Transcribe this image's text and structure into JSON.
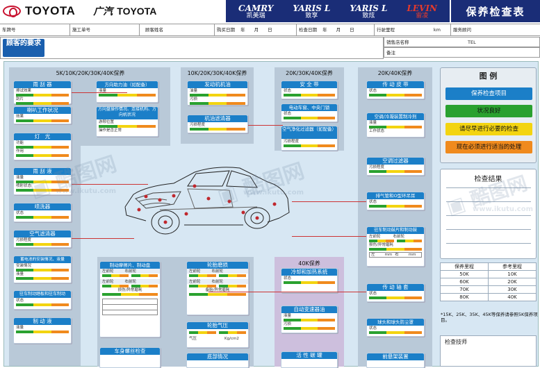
{
  "header": {
    "brand_toyota": "TOYOTA",
    "brand_gac": "广汽",
    "brand_gac_toyota": "TOYOTA",
    "models": [
      {
        "en": "CAMRY",
        "cn": "凯美瑞"
      },
      {
        "en": "YARIS L",
        "cn": "致享"
      },
      {
        "en": "YARIS L",
        "cn": "致炫"
      },
      {
        "en": "LEVIN",
        "cn": "雷凌"
      }
    ],
    "title": "保养检查表"
  },
  "form": {
    "plate": "车牌号",
    "work_order": "施工单号",
    "customer": "顾客姓名",
    "purchase_date": "购买日期",
    "purchase_ymd": "年　　月　　日",
    "inspect_date": "检查日期",
    "inspect_ymd": "年　　月　　日",
    "mileage": "行驶里程",
    "km": "km",
    "advisor": "服务顾问",
    "request_label": "顾客的要求",
    "dealer": "销售店名称",
    "tel": "TEL",
    "remark": "备注"
  },
  "columns": {
    "c1": "5K/10K/20K/30K/40K保养",
    "c2": "10K/20K/30K/40K保养",
    "c3": "20K/30K/40K保养",
    "c4": "20K/40K保养",
    "c5": "40K保养"
  },
  "cards": {
    "wiper": "雨 刮 器",
    "wiper_r1": "擦试效果",
    "wiper_r2": "刮片",
    "horn": "喇叭工作状况",
    "horn_r": "效果",
    "light": "灯　光",
    "light_r1": "功能",
    "light_r2": "作用",
    "washer_fluid": "雨 刮 液",
    "washer_r1": "液量",
    "washer_r2": "喷射状态",
    "washer": "喷洗器",
    "washer2_r": "状态",
    "aircleaner": "空气滤清器",
    "aircleaner_r": "污损程度",
    "battery": "蓄电池的安装情况、液量",
    "battery_r1": "安装情况",
    "battery_r2": "液量",
    "parking_brake": "驻车制动踏板和驻车制动",
    "pb_r": "状态",
    "brake_fluid": "制 动 液",
    "bf_r": "液量",
    "steering_fluid": "方向助力油（如配备）",
    "sf_r1": "液量",
    "sf_r2": "污损",
    "steering_op": "方向盘操作情况、连接机构、方向机状况",
    "so_r1": "游隙位置",
    "so_r2": "操作是否正常",
    "engine_oil": "发动机机油",
    "eo_r1": "油量",
    "eo_r2": "污损",
    "oil_filter": "机油滤清器",
    "of_r": "污损程度",
    "seatbelt": "安 全 带",
    "sb_r": "状态",
    "dashboard": "电动车窗、中央门锁",
    "db_r": "状态",
    "ac_filter_opt": "空气净化过滤器（如配备）",
    "acf_r": "污损程度",
    "drive_belt": "传 动 皮 带",
    "belt_r": "状态",
    "ac_refrigerant": "空调/冷凝装置制冷剂",
    "acr_r1": "液量",
    "acr_r2": "工作状态",
    "ac_filter": "空调过滤器",
    "acf2_r": "污损程度",
    "exhaust": "排气管和O型环吊耳",
    "ex_r": "状态",
    "parking_brake_drum": "驻车制动鼓片和制动鼓",
    "pbd_r1": "左前轮",
    "pbd_r2": "右前轮",
    "pbd_r3": "损伤/异常磨耗",
    "pbd_left": "左",
    "pbd_right": "右",
    "pbd_unit": "mm",
    "brake_pad": "制动摩擦片、制动盘",
    "bp_r1": "左前轮",
    "bp_r2": "右前轮",
    "bp_r3": "损伤/异常磨耗",
    "tire_wear": "轮胎磨损",
    "tw_r1": "左前轮",
    "tw_r2": "右前轮",
    "tw_r3": "备胎/异常磨耗",
    "tire_pressure": "轮胎气压",
    "tp_r1": "气压",
    "tp_unit": "Kg/cm2",
    "coolant": "冷却和加热系统",
    "cool_r": "状态",
    "auto_trans": "自动变速器油",
    "at_r1": "液量",
    "at_r2": "污损",
    "drive_shaft": "传 动 轴 套",
    "ds_r": "状态",
    "ball_joint": "球头和球头防尘罩",
    "bj_r": "状态",
    "suspension_bolt": "车身螺丝检查",
    "bottom_bolt": "底部情况",
    "piston": "活 性 碳 罐",
    "front": "前悬架装置"
  },
  "legend": {
    "title": "图 例",
    "items": [
      {
        "label": "保养检查项目",
        "color": "#1b7fc8",
        "text": "#ffffff"
      },
      {
        "label": "状况良好",
        "color": "#2aa12f",
        "text": "#111111"
      },
      {
        "label": "请尽早进行必要的检查",
        "color": "#f3d410",
        "text": "#111111"
      },
      {
        "label": "现在必须进行适当的处理",
        "color": "#f08a1d",
        "text": "#111111"
      }
    ]
  },
  "results": {
    "title": "检查结果"
  },
  "mileage_table": {
    "headers": [
      "保养里程",
      "参考里程"
    ],
    "rows": [
      [
        "50K",
        "10K"
      ],
      [
        "60K",
        "20K"
      ],
      [
        "70K",
        "30K"
      ],
      [
        "80K",
        "40K"
      ]
    ]
  },
  "mileage_note": "*15K、25K、35K、45K等保养请参照5K保养项目。",
  "technician": "检查技师",
  "watermark": "www.ikutu.com"
}
